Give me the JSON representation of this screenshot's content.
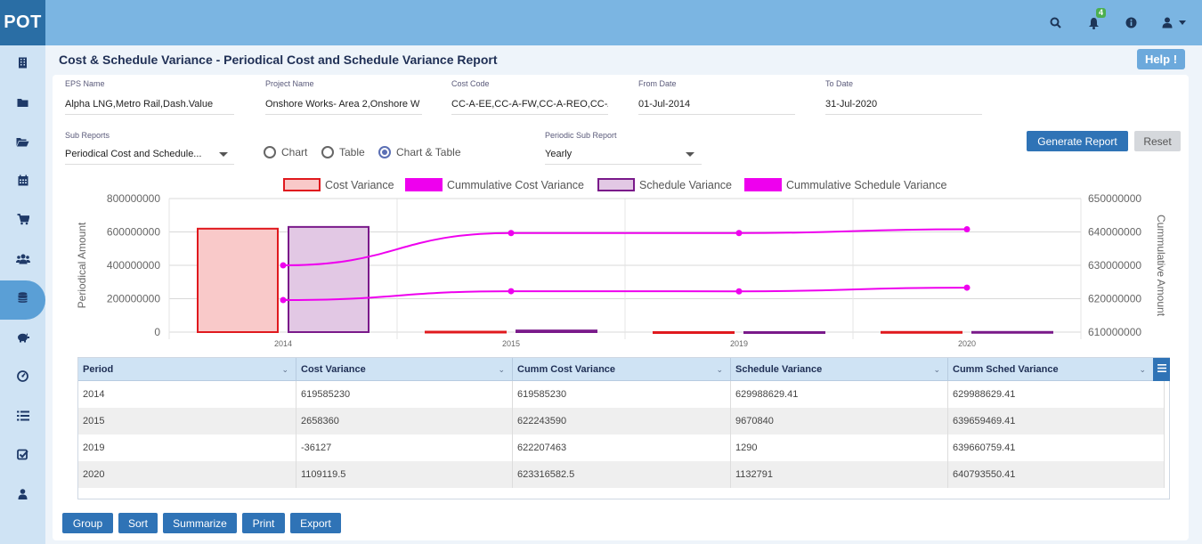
{
  "app": {
    "logo": "POT",
    "notification_count": "4"
  },
  "header_icons": [
    "search-icon",
    "bell-icon",
    "info-icon",
    "user-icon",
    "caret-down-icon"
  ],
  "sidebar": {
    "items": [
      {
        "icon": "building-icon"
      },
      {
        "icon": "folder-icon"
      },
      {
        "icon": "folder-open-icon"
      },
      {
        "icon": "calendar-icon"
      },
      {
        "icon": "cart-icon"
      },
      {
        "icon": "users-icon"
      },
      {
        "icon": "database-icon",
        "active": true
      },
      {
        "icon": "piggy-bank-icon"
      },
      {
        "icon": "dashboard-icon"
      },
      {
        "icon": "list-icon"
      },
      {
        "icon": "check-square-icon"
      },
      {
        "icon": "user-icon"
      }
    ]
  },
  "page": {
    "title": "Cost & Schedule Variance - Periodical Cost and Schedule Variance Report",
    "help_label": "Help !"
  },
  "filters": {
    "eps_name": {
      "label": "EPS Name",
      "value": "Alpha LNG,Metro Rail,Dash.Value"
    },
    "project_name": {
      "label": "Project Name",
      "value": "Onshore  Works- Area 2,Onshore  W"
    },
    "cost_code": {
      "label": "Cost Code",
      "value": "CC-A-EE,CC-A-FW,CC-A-REO,CC-A-C"
    },
    "from_date": {
      "label": "From Date",
      "value": "01-Jul-2014"
    },
    "to_date": {
      "label": "To Date",
      "value": "31-Jul-2020"
    },
    "sub_reports": {
      "label": "Sub Reports",
      "value": "Periodical Cost and Schedule..."
    },
    "view_options": [
      {
        "label": "Chart",
        "checked": false
      },
      {
        "label": "Table",
        "checked": false
      },
      {
        "label": "Chart & Table",
        "checked": true
      }
    ],
    "periodic_sub_report": {
      "label": "Periodic Sub Report",
      "value": "Yearly"
    },
    "generate_label": "Generate Report",
    "reset_label": "Reset"
  },
  "chart_data": {
    "type": "bar",
    "categories": [
      "2014",
      "2015",
      "2019",
      "2020"
    ],
    "series": [
      {
        "name": "Cost Variance",
        "type": "bar",
        "axis": "left",
        "color": "#e0191e",
        "fill": "#f9c9c9",
        "values": [
          619585230,
          2658360,
          -36127,
          1109119.5
        ]
      },
      {
        "name": "Cummulative Cost Variance",
        "type": "line",
        "axis": "right",
        "color": "#ee00ee",
        "values": [
          619585230,
          622243590,
          622207463,
          623316582.5
        ]
      },
      {
        "name": "Schedule Variance",
        "type": "bar",
        "axis": "left",
        "color": "#7a1a8a",
        "fill": "#e2c8e4",
        "values": [
          629988629.41,
          9670840,
          1290,
          1132791
        ]
      },
      {
        "name": "Cummulative Schedule Variance",
        "type": "line",
        "axis": "right",
        "color": "#ee00ee",
        "values": [
          629988629.41,
          639659469.41,
          639660759.41,
          640793550.41
        ]
      }
    ],
    "ylabel": "Periodical Amount",
    "y2label": "Cummulative Amount",
    "ylim": [
      0,
      800000000
    ],
    "y2lim": [
      610000000,
      650000000
    ],
    "yticks": [
      "800000000",
      "600000000",
      "400000000",
      "200000000",
      "0"
    ],
    "y2ticks": [
      "650000000",
      "640000000",
      "630000000",
      "620000000",
      "610000000"
    ],
    "legend": "top",
    "grid": true
  },
  "table": {
    "columns": [
      "Period",
      "Cost Variance",
      "Cumm Cost Variance",
      "Schedule Variance",
      "Cumm Sched Variance"
    ],
    "rows": [
      [
        "2014",
        "619585230",
        "619585230",
        "629988629.41",
        "629988629.41"
      ],
      [
        "2015",
        "2658360",
        "622243590",
        "9670840",
        "639659469.41"
      ],
      [
        "2019",
        "-36127",
        "622207463",
        "1290",
        "639660759.41"
      ],
      [
        "2020",
        "1109119.5",
        "623316582.5",
        "1132791",
        "640793550.41"
      ]
    ]
  },
  "bottom_buttons": [
    "Group",
    "Sort",
    "Summarize",
    "Print",
    "Export"
  ]
}
